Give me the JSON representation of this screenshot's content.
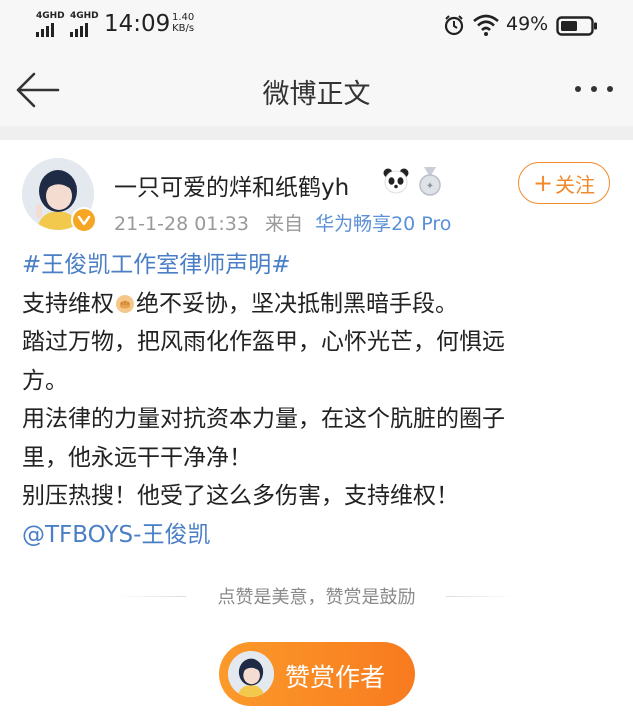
{
  "status_bar": {
    "signal1_label": "4GHD",
    "signal2_label": "4GHD",
    "time": "14:09",
    "speed_value": "1.40",
    "speed_unit": "KB/s",
    "battery": "49%"
  },
  "nav": {
    "title": "微博正文",
    "back_icon": "arrow-left-icon",
    "more_icon": "more-dots-icon"
  },
  "post": {
    "username": "一只可爱的烊和纸鹤yh",
    "timestamp": "21-1-28 01:33",
    "source_prefix": "来自",
    "source_device": "华为畅享20 Pro",
    "follow_label": "关注",
    "hashtag": "#王俊凯工作室律师声明#",
    "line1_a": "支持维权",
    "line1_b": "绝不妥协，坚决抵制黑暗手段。",
    "line2": "踏过万物，把风雨化作盔甲，心怀光芒，何惧远",
    "line3": "方。",
    "line4": "用法律的力量对抗资本力量，在这个肮脏的圈子",
    "line5": "里，他永远干干净净！",
    "line6": "别压热搜！他受了这么多伤害，支持维权！",
    "mention": "@TFBOYS-王俊凯"
  },
  "reward": {
    "hint": "点赞是美意，赞赏是鼓励",
    "button_label": "赞赏作者"
  },
  "colors": {
    "accent_orange": "#f08a2c",
    "link_blue": "#4a7fc6",
    "source_blue": "#5b8fd6",
    "reward_gradient_start": "#fb9a2a",
    "reward_gradient_end": "#f87a1f"
  }
}
